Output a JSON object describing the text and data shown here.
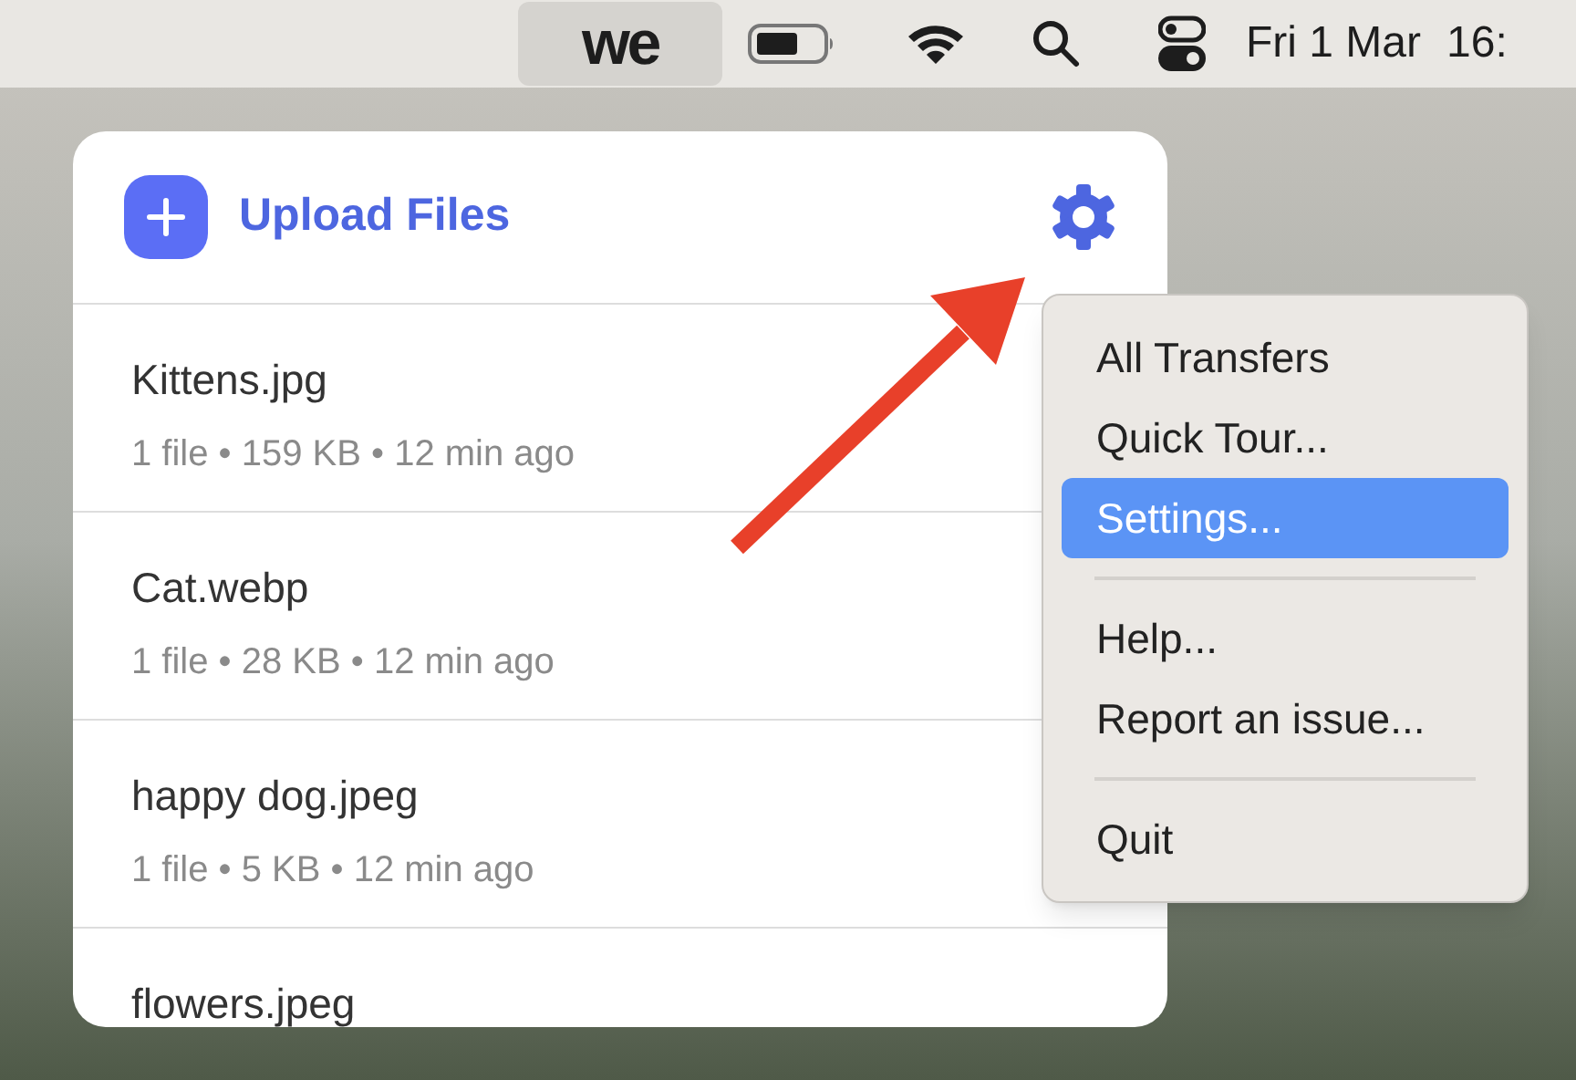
{
  "menu_bar": {
    "app_logo": {
      "text": "we",
      "selected": true
    },
    "date": "Fri 1 Mar",
    "time": "16:"
  },
  "popover": {
    "upload_button": "Upload Files",
    "transfers": [
      {
        "name": "Kittens.jpg",
        "details": "1 file • 159 KB • 12 min ago"
      },
      {
        "name": "Cat.webp",
        "details": "1 file • 28 KB • 12 min ago"
      },
      {
        "name": "happy dog.jpeg",
        "details": "1 file • 5 KB • 12 min ago"
      },
      {
        "name": "flowers.jpeg"
      }
    ]
  },
  "menu": {
    "items": [
      {
        "kind": "item",
        "label": "All Transfers",
        "selected": false
      },
      {
        "kind": "item",
        "label": "Quick Tour...",
        "selected": false
      },
      {
        "kind": "item",
        "label": "Settings...",
        "selected": true
      },
      {
        "kind": "separator"
      },
      {
        "kind": "item",
        "label": "Help...",
        "selected": false
      },
      {
        "kind": "item",
        "label": "Report an issue...",
        "selected": false
      },
      {
        "kind": "separator"
      },
      {
        "kind": "item",
        "label": "Quit",
        "selected": false
      }
    ]
  }
}
